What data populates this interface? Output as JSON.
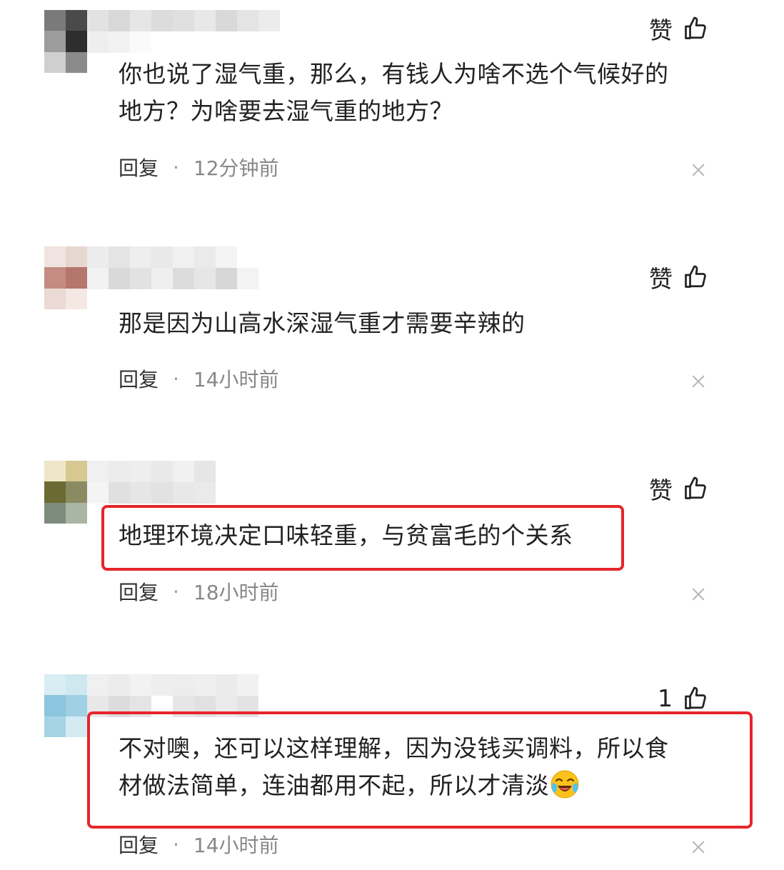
{
  "comments": [
    {
      "text_lines": [
        "你也说了湿气重，那么，有钱人为啥不选个气候好的",
        "地方？为啥要去湿气重的地方？"
      ],
      "like_label": "赞",
      "reply_label": "回复",
      "separator": "·",
      "time": "12分钟前",
      "highlighted": false
    },
    {
      "text_lines": [
        "那是因为山高水深湿气重才需要辛辣的"
      ],
      "like_label": "赞",
      "reply_label": "回复",
      "separator": "·",
      "time": "14小时前",
      "highlighted": false
    },
    {
      "text_lines": [
        "地理环境决定口味轻重，与贫富毛的个关系"
      ],
      "like_label": "赞",
      "reply_label": "回复",
      "separator": "·",
      "time": "18小时前",
      "highlighted": true
    },
    {
      "text_lines": [
        "不对噢，还可以这样理解，因为没钱买调料，所以食",
        "材做法简单，连油都用不起，所以才清淡"
      ],
      "emoji": "crying-laughing-emoji",
      "like_label": "1",
      "reply_label": "回复",
      "separator": "·",
      "time": "14小时前",
      "highlighted": true
    }
  ],
  "colors": {
    "highlight_border": "#e5262b",
    "text": "#222222",
    "time": "#888888"
  }
}
